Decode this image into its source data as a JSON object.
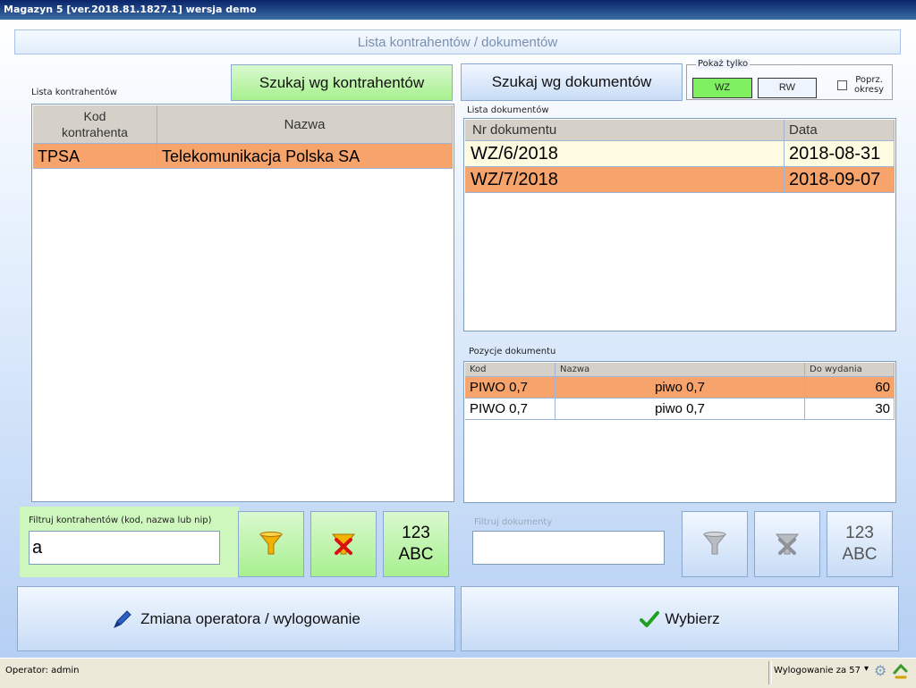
{
  "window": {
    "title": "Magazyn 5 [ver.2018.81.1827.1]  wersja demo"
  },
  "header": {
    "title": "Lista kontrahentów / dokumentów"
  },
  "left": {
    "list_label": "Lista kontrahentów",
    "search_button": "Szukaj wg kontrahentów",
    "columns": [
      "Kod\nkontrahenta",
      "Nazwa"
    ],
    "rows": [
      {
        "kod": "TPSA",
        "nazwa": "Telekomunikacja Polska SA"
      }
    ],
    "filter_label": "Filtruj kontrahentów (kod, nazwa lub nip)",
    "filter_value": "a",
    "keyboard_label_top": "123",
    "keyboard_label_bottom": "ABC"
  },
  "right": {
    "search_button": "Szukaj wg dokumentów",
    "show_only": {
      "legend": "Pokaż tylko",
      "wz": "WZ",
      "rw": "RW",
      "prev_label_1": "Poprz.",
      "prev_label_2": "okresy"
    },
    "docs_label": "Lista dokumentów",
    "doc_columns": [
      "Nr dokumentu",
      "Data"
    ],
    "docs": [
      {
        "nr": "WZ/6/2018",
        "data": "2018-08-31"
      },
      {
        "nr": "WZ/7/2018",
        "data": "2018-09-07"
      }
    ],
    "items_label": "Pozycje dokumentu",
    "item_columns": [
      "Kod",
      "Nazwa",
      "Do wydania"
    ],
    "items": [
      {
        "kod": "PIWO 0,7",
        "nazwa": "piwo 0,7",
        "ilosc": "60"
      },
      {
        "kod": "PIWO 0,7",
        "nazwa": "piwo 0,7",
        "ilosc": "30"
      }
    ],
    "filter_label": "Filtruj dokumenty",
    "filter_value": "",
    "keyboard_label_top": "123",
    "keyboard_label_bottom": "ABC"
  },
  "actions": {
    "logout": "Zmiana operatora / wylogowanie",
    "select": "Wybierz"
  },
  "status": {
    "operator": "Operator: admin",
    "logout_timer": "Wylogowanie za 57"
  },
  "colors": {
    "selected_row": "#f6a46b",
    "green_button": "#a8f08f",
    "accent_blue": "#1f5fbf"
  }
}
